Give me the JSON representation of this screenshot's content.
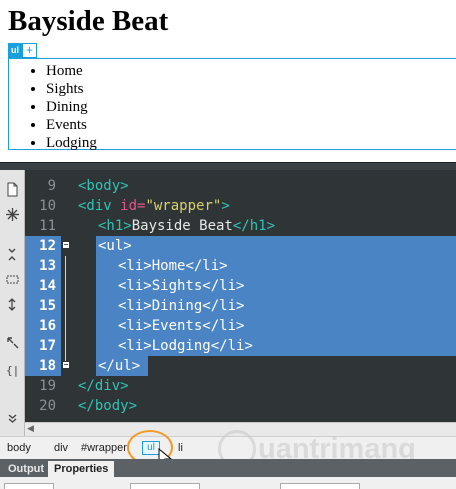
{
  "live_view": {
    "heading": "Bayside Beat",
    "hud_tag": "ul",
    "hud_plus": "+",
    "list_items": [
      "Home",
      "Sights",
      "Dining",
      "Events",
      "Lodging"
    ]
  },
  "code_view": {
    "lines": [
      {
        "num": "9",
        "selected": false
      },
      {
        "num": "10",
        "selected": false
      },
      {
        "num": "11",
        "selected": false
      },
      {
        "num": "12",
        "selected": true
      },
      {
        "num": "13",
        "selected": true
      },
      {
        "num": "14",
        "selected": true
      },
      {
        "num": "15",
        "selected": true
      },
      {
        "num": "16",
        "selected": true
      },
      {
        "num": "17",
        "selected": true
      },
      {
        "num": "18",
        "selected": true
      },
      {
        "num": "19",
        "selected": false
      },
      {
        "num": "20",
        "selected": false
      }
    ],
    "code": {
      "l9": "<body>",
      "l10_open": "<div ",
      "l10_attr": "id=",
      "l10_val": "\"wrapper\"",
      "l10_close": ">",
      "l11_open": "<h1>",
      "l11_text": "Bayside Beat",
      "l11_close": "</h1>",
      "l12": "<ul>",
      "l13_open": "<li>",
      "l13_text": "Home",
      "l13_close": "</li>",
      "l14_open": "<li>",
      "l14_text": "Sights",
      "l14_close": "</li>",
      "l15_open": "<li>",
      "l15_text": "Dining",
      "l15_close": "</li>",
      "l16_open": "<li>",
      "l16_text": "Events",
      "l16_close": "</li>",
      "l17_open": "<li>",
      "l17_text": "Lodging",
      "l17_close": "</li>",
      "l18": "</ul>",
      "l19": "</div>",
      "l20": "</body>"
    },
    "fold_symbol": "−"
  },
  "tag_selector": {
    "crumbs": [
      "body",
      "div",
      "#wrapper",
      "ul",
      "li"
    ]
  },
  "watermark": {
    "text": "uantrimang"
  },
  "panel": {
    "tabs": [
      "Output",
      "Properties"
    ]
  },
  "colors": {
    "accent": "#1aa1dd",
    "selection": "#4a84c4",
    "editor_bg": "#2f3437",
    "tag": "#2fc3b6",
    "attr": "#e0568a",
    "value": "#d8d26c",
    "highlight_ring": "#f39a25"
  },
  "icons": [
    "file-icon",
    "snowflake-icon",
    "collapse-full-tag-icon",
    "collapse-selection-icon",
    "expand-all-icon",
    "select-parent-tag-icon",
    "balance-braces-icon",
    "more-icon",
    "watermark-bulb-icon",
    "cursor-pointer-icon"
  ]
}
